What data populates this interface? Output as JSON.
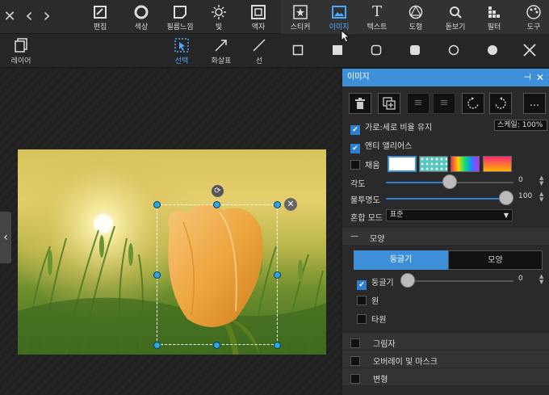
{
  "toolbar": {
    "nav": {
      "close": "✕",
      "back": "‹",
      "forward": "›"
    },
    "tools": [
      {
        "label": "편집"
      },
      {
        "label": "색상"
      },
      {
        "label": "필름느낌"
      },
      {
        "label": "빛"
      },
      {
        "label": "액자"
      },
      {
        "label": "스티커"
      },
      {
        "label": "이미지"
      },
      {
        "label": "텍스트"
      },
      {
        "label": "도형"
      },
      {
        "label": "돋보기"
      },
      {
        "label": "필터"
      },
      {
        "label": "도구"
      }
    ],
    "active_tool": "이미지"
  },
  "subbar": {
    "layer_label": "레이어",
    "select_label": "선택",
    "arrow_label": "화살표",
    "line_label": "선"
  },
  "panel": {
    "title": "이미지",
    "keep_ratio": {
      "label": "가로:세로 비율 유지",
      "checked": true
    },
    "scale_text": "스케일: 100%",
    "anti_alias": {
      "label": "앤티 앨리어스",
      "checked": true
    },
    "fill": {
      "label": "채움",
      "checked": false
    },
    "angle": {
      "label": "각도",
      "value": "0"
    },
    "opacity": {
      "label": "불투명도",
      "value": "100"
    },
    "blend": {
      "label": "혼합 모드",
      "value": "표준"
    },
    "shape_section": {
      "label": "모양",
      "toggle": "—"
    },
    "shape_tabs": {
      "rounded": "둥글기",
      "shape": "모양"
    },
    "rounding": {
      "label": "둥글기",
      "checked": true,
      "value": "0"
    },
    "circle": {
      "label": "원",
      "checked": false
    },
    "ellipse": {
      "label": "타원",
      "checked": false
    },
    "shadow": {
      "label": "그림자",
      "checked": false
    },
    "overlay": {
      "label": "오버레이 및 마스크",
      "checked": false
    },
    "transform": {
      "label": "변형",
      "checked": false
    },
    "more_label": "..."
  },
  "colors": {
    "accent": "#3d8fd8",
    "active_text": "#49a9ff"
  }
}
